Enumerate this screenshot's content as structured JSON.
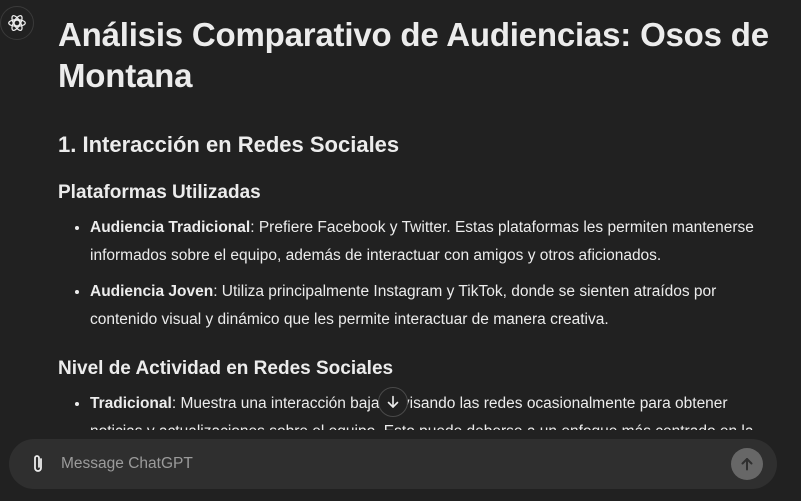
{
  "title": "Análisis Comparativo de Audiencias: Osos de Montana",
  "section1": {
    "heading": "1. Interacción en Redes Sociales",
    "sub1": {
      "heading": "Plataformas Utilizadas",
      "items": [
        {
          "label": "Audiencia Tradicional",
          "text": ": Prefiere Facebook y Twitter. Estas plataformas les permiten mantenerse informados sobre el equipo, además de interactuar con amigos y otros aficionados."
        },
        {
          "label": "Audiencia Joven",
          "text": ": Utiliza principalmente Instagram y TikTok, donde se sienten atraídos por contenido visual y dinámico que les permite interactuar de manera creativa."
        }
      ]
    },
    "sub2": {
      "heading": "Nivel de Actividad en Redes Sociales",
      "items": [
        {
          "label": "Tradicional",
          "text": ": Muestra una interacción baja, revisando las redes ocasionalmente para obtener noticias y actualizaciones sobre el equipo. Esto puede deberse a un enfoque más centrado en la"
        }
      ]
    }
  },
  "composer": {
    "placeholder": "Message ChatGPT"
  },
  "icons": {
    "avatar": "openai-logo-icon",
    "scroll": "arrow-down-icon",
    "attach": "paperclip-icon",
    "send": "arrow-up-icon"
  }
}
